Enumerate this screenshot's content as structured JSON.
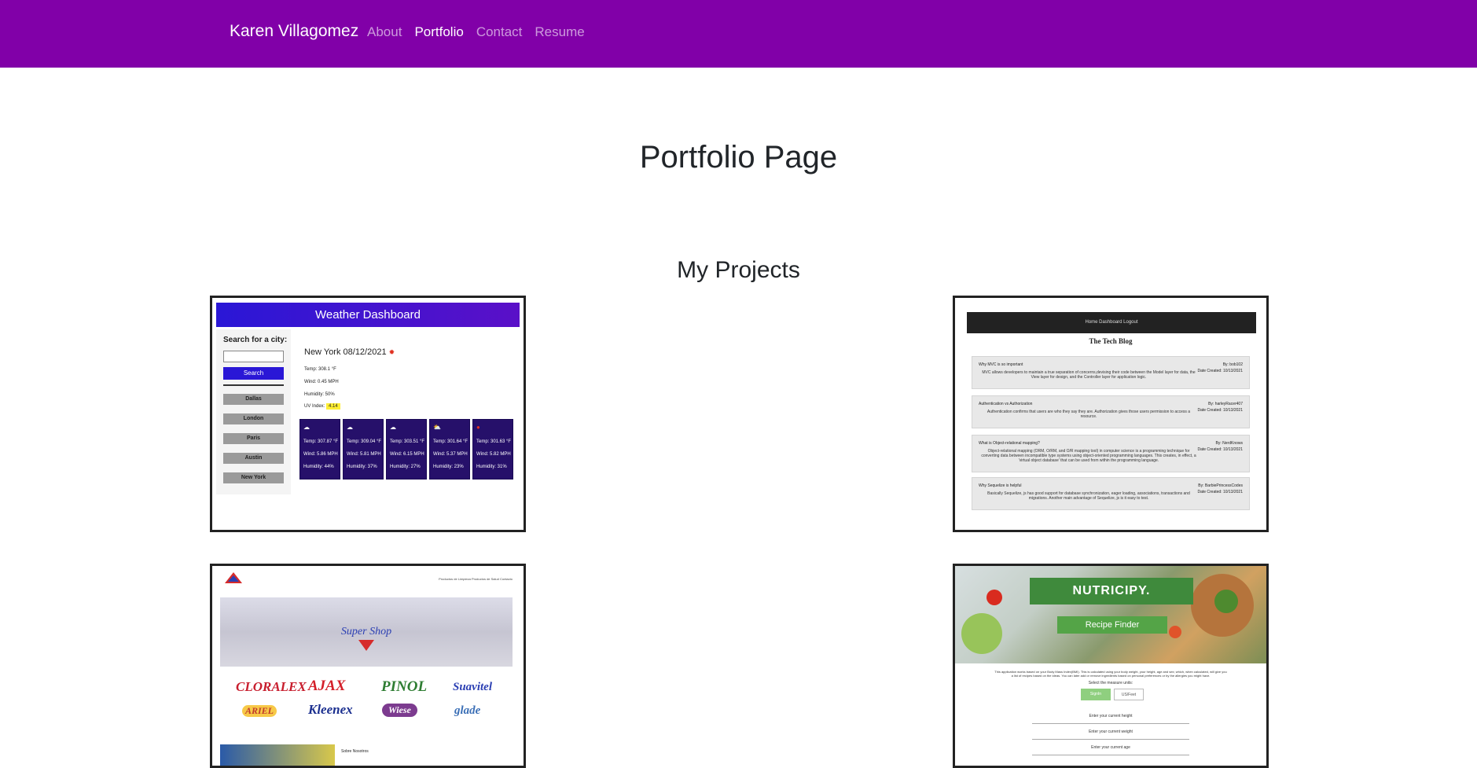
{
  "navbar": {
    "brand": "Karen Villagomez",
    "links": [
      "About",
      "Portfolio",
      "Contact",
      "Resume"
    ],
    "active": "Portfolio",
    "color": "#8100a8"
  },
  "page_title": "Portfolio Page",
  "section_title": "My Projects",
  "projects": [
    {
      "title": "Weather Dashboard",
      "search_label": "Search for a city:",
      "search_button": "Search",
      "cities": [
        "Dallas",
        "London",
        "Paris",
        "Austin",
        "New York"
      ],
      "current_city": "New York 08/12/2021",
      "temp": "Temp: 308.1 °F",
      "wind": "Wind: 0.45 MPH",
      "humidity": "Humidity: 50%",
      "uv_label": "UV Index:",
      "uv_value": "4.14",
      "forecast": [
        {
          "temp": "Temp: 307.87 °F",
          "wind": "Wind: 5.86 MPH",
          "humidity": "Humidity: 44%"
        },
        {
          "temp": "Temp: 309.04 °F",
          "wind": "Wind: 5.81 MPH",
          "humidity": "Humidity: 37%"
        },
        {
          "temp": "Temp: 303.51 °F",
          "wind": "Wind: 6.15 MPH",
          "humidity": "Humidity: 27%"
        },
        {
          "temp": "Temp: 301.64 °F",
          "wind": "Wind: 5.37 MPH",
          "humidity": "Humidity: 23%"
        },
        {
          "temp": "Temp: 301.63 °F",
          "wind": "Wind: 5.82 MPH",
          "humidity": "Humidity: 31%"
        }
      ]
    },
    {
      "title": "The Tech Blog",
      "nav": "Home   Dashboard   Logout",
      "posts": [
        {
          "title": "Why MVC is so important",
          "author": "By: bob102",
          "date": "Date Created: 10/13/2021",
          "body": "MVC allows developers to maintain a true separation of concerns,devising their code between the Model layer for data, the View layer for design, and the Controller layer for application logic."
        },
        {
          "title": "Authentication vs Authorization",
          "author": "By: harleyRacer407",
          "date": "Date Created: 10/13/2021",
          "body": "Authentication confirms that users are who they say they are. Authorization gives those users permission to access a resource."
        },
        {
          "title": "What is Object-relational mapping?",
          "author": "By: NerdKnows",
          "date": "Date Created: 10/13/2021",
          "body": "Object-relational mapping (ORM, O/RM, and O/R mapping tool) in computer science is a programming technique for converting data between incompatible type systems using object-oriented programming languages. This creates, in effect, a 'virtual object database' that can be used from within the programming language."
        },
        {
          "title": "Why Sequelize is helpful",
          "author": "By: BarbiePrincessCodes",
          "date": "Date Created: 10/13/2021",
          "body": "Basically Sequelize, js has good support for database synchronization, eager loading, associations, transactions and migrations. Another main advantage of Sequelize, js is it easy to test."
        }
      ]
    },
    {
      "title": "Super Shop",
      "nav": "Productos de Limpieza   Productos de Salud   Contacto",
      "banner_text": "Super Shop",
      "brands": [
        "CLORALEX",
        "AJAX",
        "PINOL",
        "Suavitel",
        "ARIEL",
        "Kleenex",
        "Wiese",
        "glade"
      ],
      "about": "Sobre Nosotros"
    },
    {
      "title": "NUTRICIPY.",
      "button": "Recipe Finder",
      "description": "This application works based on your Body Mass Index(BMI). This is calculated using your body weight, your height, age and sex; which, when calculated, will give you a list of recipes based on the ideas. You can later add or remove ingredients based on personal preferences or by the allergies you might have.",
      "select_label": "Select the measure units:",
      "unit_metric": "SignIn",
      "unit_us": "US/Feet",
      "fields": [
        "Enter your current height",
        "Enter your current weight",
        "Enter your current age"
      ]
    }
  ]
}
